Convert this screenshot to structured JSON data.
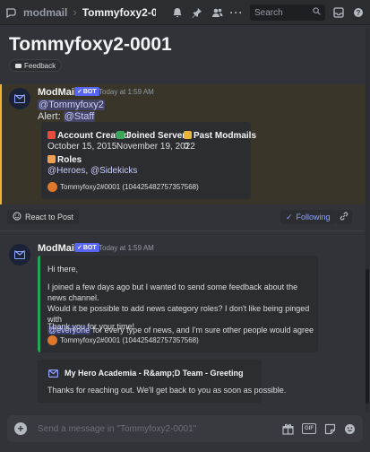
{
  "topbar": {
    "channel": "modmail",
    "thread": "Tommyfoxy2-0001",
    "search_placeholder": "Search"
  },
  "header": {
    "title": "Tommyfoxy2-0001",
    "tag": "Feedback"
  },
  "starter_message": {
    "author": "ModMail",
    "bot_badge": "BOT",
    "timestamp": "Today at 1:59 AM",
    "mention_user": "@Tommyfoxy2",
    "alert_prefix": "Alert:",
    "alert_role": "@Staff",
    "embed": {
      "account_created_label": "Account Created",
      "account_created_value": "October 15, 2015",
      "joined_server_label": "Joined Server",
      "joined_server_value": "November 19, 2022",
      "past_modmails_label": "Past Modmails",
      "past_modmails_value": "0",
      "roles_label": "Roles",
      "role_1": "@Heroes",
      "role_sep": ",",
      "role_2": "@Sidekicks",
      "footer": "Tommyfoxy2#0001 (104425482757357568)"
    }
  },
  "thread_bar": {
    "react_label": "React to Post",
    "following_label": "Following"
  },
  "reply_message": {
    "author": "ModMail",
    "bot_badge": "BOT",
    "timestamp": "Today at 1:59 AM",
    "embed": {
      "greeting": "Hi there,",
      "para_line1": "I joined a few days ago but I wanted to send some feedback about the news channel.",
      "para_line2": "Would it be possible to add news category roles? I don't like being pinged with",
      "para_mention": "@everyone",
      "para_line3_rest": " for every type of news, and I'm sure other people would agree",
      "thanks": "Thank you for your time!",
      "footer": "Tommyfoxy2#0001 (104425482757357568)"
    },
    "reply_embed": {
      "title": "My Hero Academia - R&amp;D Team - Greeting",
      "text": "Thanks for reaching out. We'll get back to you as soon as possible."
    }
  },
  "composer": {
    "placeholder": "Send a message in \"Tommyfoxy2-0001\"",
    "gif_label": "GIF"
  },
  "colors": {
    "background": "#313338",
    "highlight": "#3a3529",
    "accent": "#5865f2",
    "embed_border_green": "#23a55a"
  }
}
